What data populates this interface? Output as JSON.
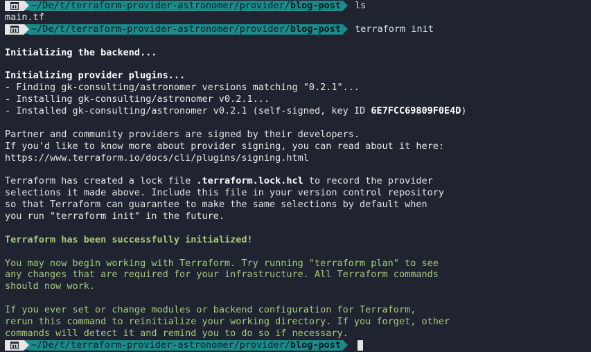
{
  "prompt": {
    "path_prefix": "~/De/t/terraform-provider-astronomer/provider/",
    "path_current": "blog-post"
  },
  "commands": {
    "first": "ls",
    "second": "terraform init"
  },
  "output": {
    "ls_result": "main.tf",
    "init_backend": "Initializing the backend...",
    "init_plugins": "Initializing provider plugins...",
    "finding": "- Finding gk-consulting/astronomer versions matching \"0.2.1\"...",
    "installing": "- Installing gk-consulting/astronomer v0.2.1...",
    "installed_prefix": "- Installed gk-consulting/astronomer v0.2.1 (self-signed, key ID ",
    "installed_key": "6E7FCC69809F0E4D",
    "installed_suffix": ")",
    "partner_1": "Partner and community providers are signed by their developers.",
    "partner_2": "If you'd like to know more about provider signing, you can read about it here:",
    "partner_3": "https://www.terraform.io/docs/cli/plugins/signing.html",
    "lock_1_prefix": "Terraform has created a lock file ",
    "lock_1_file": ".terraform.lock.hcl",
    "lock_1_suffix": " to record the provider",
    "lock_2": "selections it made above. Include this file in your version control repository",
    "lock_3": "so that Terraform can guarantee to make the same selections by default when",
    "lock_4": "you run \"terraform init\" in the future.",
    "success": "Terraform has been successfully initialized!",
    "next_1": "You may now begin working with Terraform. Try running \"terraform plan\" to see",
    "next_2": "any changes that are required for your infrastructure. All Terraform commands",
    "next_3": "should now work.",
    "rerun_1": "If you ever set or change modules or backend configuration for Terraform,",
    "rerun_2": "rerun this command to reinitialize your working directory. If you forget, other",
    "rerun_3": "commands will detect it and remind you to do so if necessary."
  },
  "colors": {
    "background": "#1f2430",
    "text": "#e6e6e6",
    "prompt_path_bg": "#1a8a8a",
    "success_green": "#a9c97e"
  },
  "icons": {
    "prompt_os": "terminal-app-icon"
  }
}
